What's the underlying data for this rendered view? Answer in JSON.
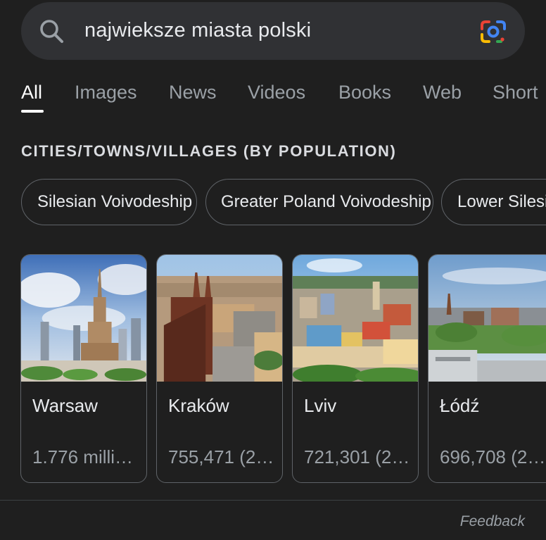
{
  "search": {
    "query": "najwieksze miasta polski",
    "icon": "search-icon",
    "lens_icon": "google-lens-icon"
  },
  "tabs": [
    {
      "label": "All",
      "active": true
    },
    {
      "label": "Images",
      "active": false
    },
    {
      "label": "News",
      "active": false
    },
    {
      "label": "Videos",
      "active": false
    },
    {
      "label": "Books",
      "active": false
    },
    {
      "label": "Web",
      "active": false
    },
    {
      "label": "Short",
      "active": false
    }
  ],
  "section": {
    "heading": "CITIES/TOWNS/VILLAGES (BY POPULATION)"
  },
  "chips": [
    {
      "label": "Silesian Voivodeship"
    },
    {
      "label": "Greater Poland Voivodeship"
    },
    {
      "label": "Lower Silesia"
    }
  ],
  "cards": [
    {
      "name": "Warsaw",
      "population": "1.776 milli…"
    },
    {
      "name": "Kraków",
      "population": "755,471 (2…"
    },
    {
      "name": "Lviv",
      "population": "721,301 (2…"
    },
    {
      "name": "Łódź",
      "population": "696,708 (2…"
    }
  ],
  "footer": {
    "feedback": "Feedback"
  },
  "colors": {
    "background": "#1f1f1f",
    "search_bg": "#303134",
    "border": "#5f6368",
    "text_primary": "#e8eaed",
    "text_secondary": "#9aa0a6",
    "lens_blue": "#4285f4",
    "lens_red": "#ea4335",
    "lens_yellow": "#fbbc04",
    "lens_green": "#34a853"
  }
}
